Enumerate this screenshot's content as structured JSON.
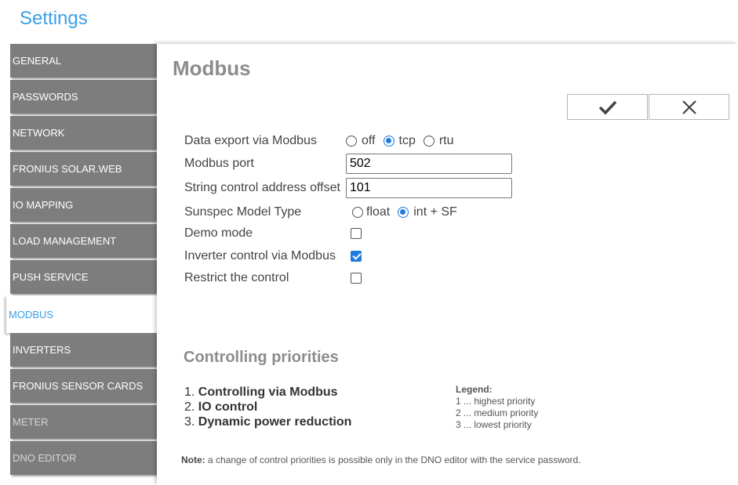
{
  "app": {
    "title": "Settings"
  },
  "sidebar": {
    "items": [
      {
        "label": "GENERAL",
        "state": "normal"
      },
      {
        "label": "PASSWORDS",
        "state": "normal"
      },
      {
        "label": "NETWORK",
        "state": "normal"
      },
      {
        "label": "FRONIUS SOLAR.WEB",
        "state": "normal"
      },
      {
        "label": "IO MAPPING",
        "state": "normal"
      },
      {
        "label": "LOAD MANAGEMENT",
        "state": "normal"
      },
      {
        "label": "PUSH SERVICE",
        "state": "normal"
      },
      {
        "label": "MODBUS",
        "state": "active"
      },
      {
        "label": "INVERTERS",
        "state": "normal"
      },
      {
        "label": "FRONIUS SENSOR CARDS",
        "state": "normal"
      },
      {
        "label": "METER",
        "state": "dim"
      },
      {
        "label": "DNO EDITOR",
        "state": "dim"
      }
    ]
  },
  "main": {
    "title": "Modbus",
    "buttons": {
      "save_icon": "checkmark-icon",
      "cancel_icon": "close-icon"
    },
    "form": {
      "data_export": {
        "label": "Data export via Modbus",
        "options": [
          "off",
          "tcp",
          "rtu"
        ],
        "selected": "tcp"
      },
      "modbus_port": {
        "label": "Modbus port",
        "value": "502"
      },
      "address_offset": {
        "label": "String control address offset",
        "value": "101"
      },
      "sunspec_model": {
        "label": "Sunspec Model Type",
        "options": [
          "float",
          "int + SF"
        ],
        "selected": "int + SF"
      },
      "demo_mode": {
        "label": "Demo mode",
        "checked": false
      },
      "inverter_control": {
        "label": "Inverter control via Modbus",
        "checked": true
      },
      "restrict_control": {
        "label": "Restrict the control",
        "checked": false
      }
    },
    "priorities": {
      "title": "Controlling priorities",
      "items": [
        {
          "num": "1.",
          "text": "Controlling via Modbus"
        },
        {
          "num": "2.",
          "text": "IO control"
        },
        {
          "num": "3.",
          "text": "Dynamic power reduction"
        }
      ],
      "legend": {
        "title": "Legend:",
        "items": [
          "1 ... highest priority",
          "2 ... medium priority",
          "3 ... lowest priority"
        ]
      }
    },
    "note": {
      "prefix": "Note:",
      "text": " a change of control priorities is possible only in the DNO editor with the service password."
    }
  },
  "colors": {
    "accent": "#3aa0e8",
    "sidebar_bg": "#7d7d7d",
    "control_blue": "#1f7bdc"
  }
}
